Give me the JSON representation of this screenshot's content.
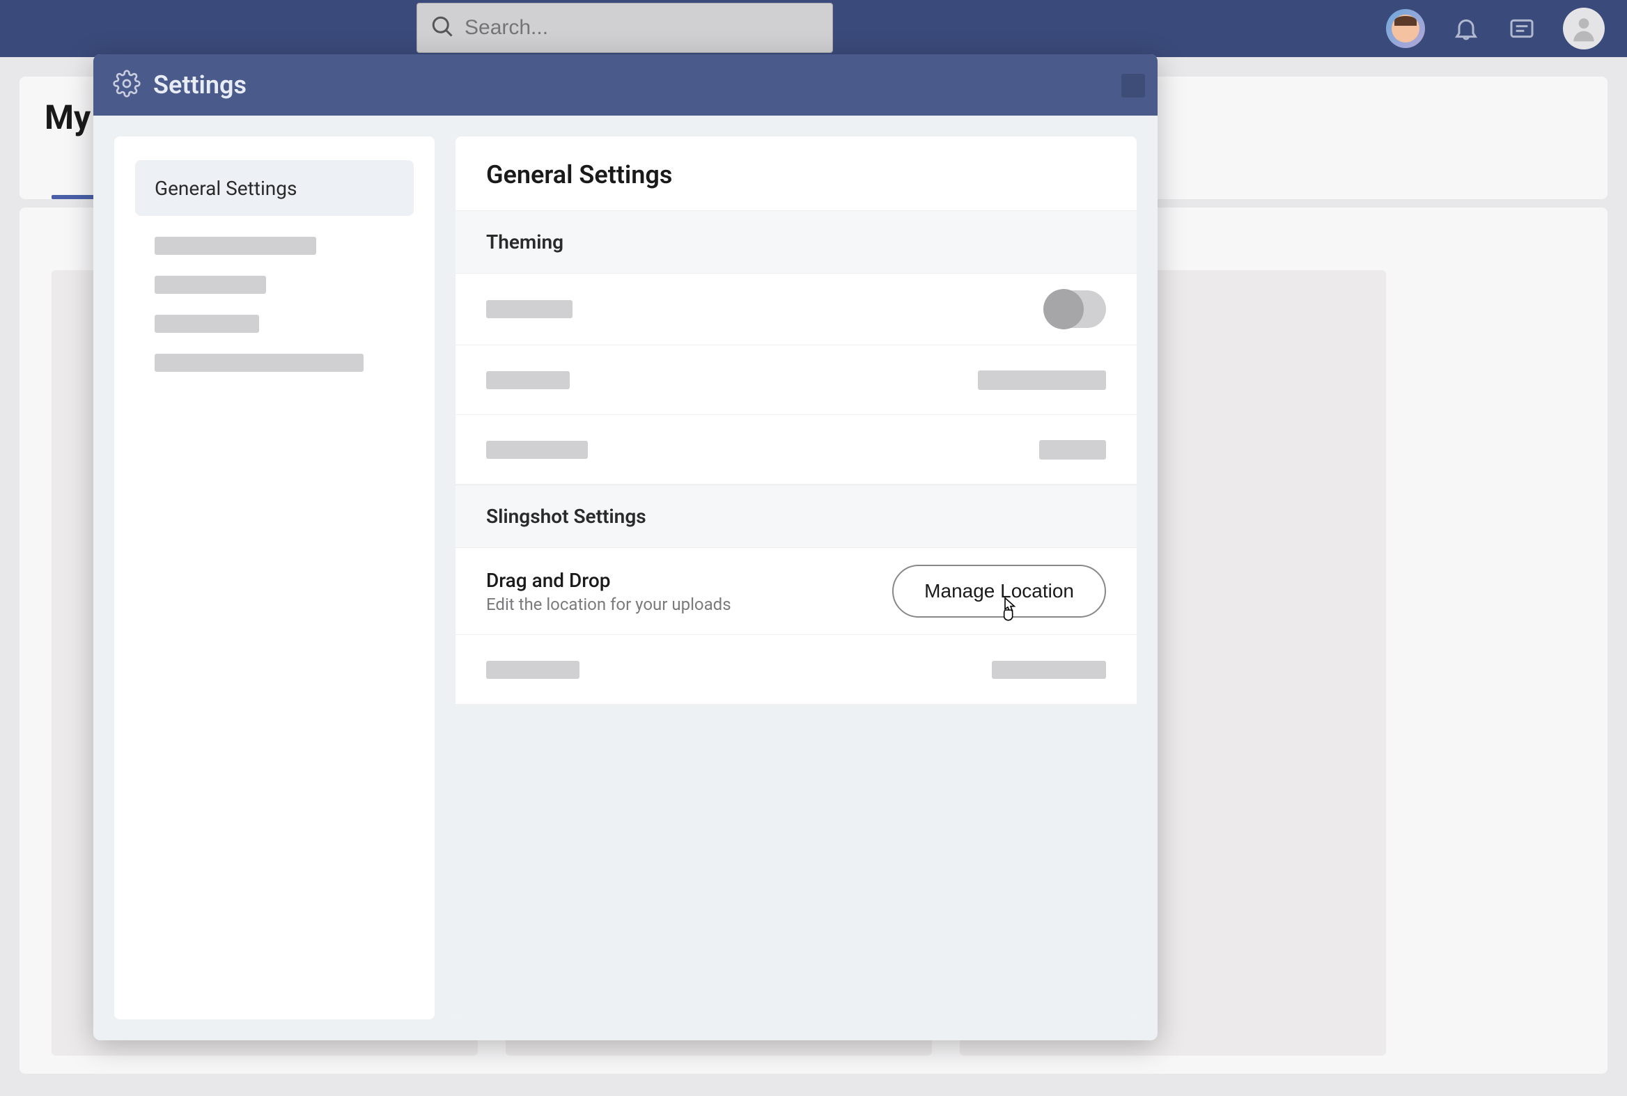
{
  "topbar": {
    "search_placeholder": "Search..."
  },
  "page": {
    "title": "My S"
  },
  "modal": {
    "title": "Settings",
    "sidebar": {
      "active_item": "General Settings"
    },
    "panel": {
      "title": "General Settings",
      "sections": {
        "theming": {
          "title": "Theming"
        },
        "slingshot": {
          "title": "Slingshot Settings",
          "drag_drop": {
            "label": "Drag and Drop",
            "sublabel": "Edit the location for your uploads",
            "button": "Manage Location"
          }
        }
      }
    }
  }
}
